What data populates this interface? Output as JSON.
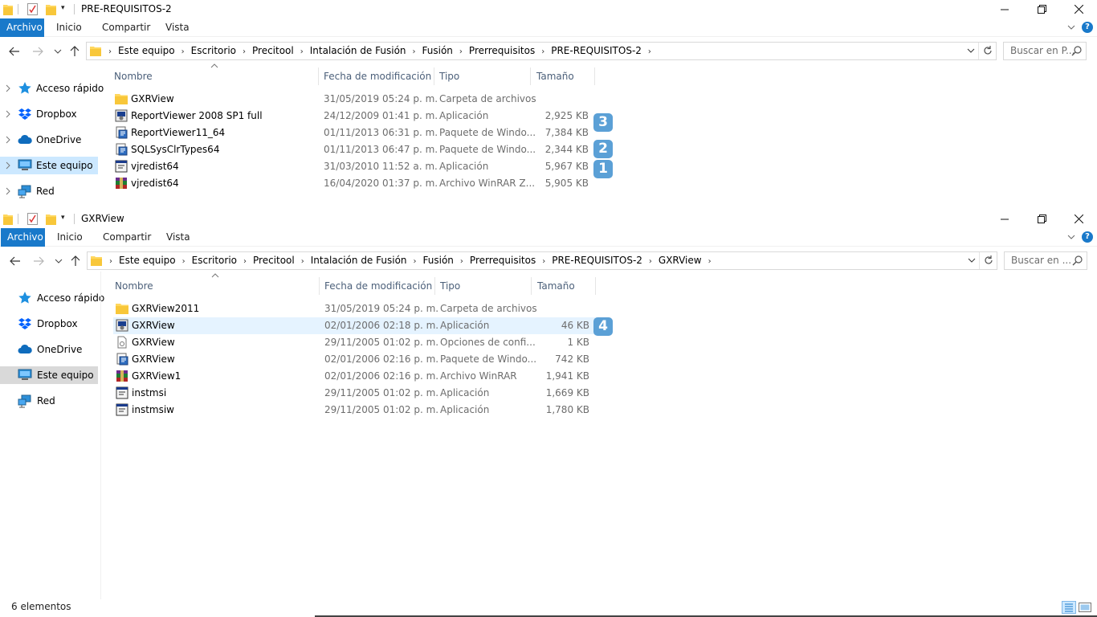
{
  "windows": [
    {
      "title": "PRE-REQUISITOS-2",
      "ribbon": {
        "file": "Archivo",
        "home": "Inicio",
        "share": "Compartir",
        "view": "Vista"
      },
      "breadcrumbs": [
        "Este equipo",
        "Escritorio",
        "Precitool",
        "Intalación de Fusión",
        "Fusión",
        "Prerrequisitos",
        "PRE-REQUISITOS-2"
      ],
      "search_placeholder": "Buscar en P...",
      "nav": [
        "Acceso rápido",
        "Dropbox",
        "OneDrive",
        "Este equipo",
        "Red"
      ],
      "columns": {
        "name": "Nombre",
        "date": "Fecha de modificación",
        "type": "Tipo",
        "size": "Tamaño"
      },
      "files": [
        {
          "name": "GXRView",
          "date": "31/05/2019 05:24 p. m.",
          "type": "Carpeta de archivos",
          "size": "",
          "icon": "folder-icon"
        },
        {
          "name": "ReportViewer 2008 SP1 full",
          "date": "24/12/2009 01:41 p. m.",
          "type": "Aplicación",
          "size": "2,925 KB",
          "icon": "installer-icon"
        },
        {
          "name": "ReportViewer11_64",
          "date": "01/11/2013 06:31 p. m.",
          "type": "Paquete de Windo...",
          "size": "7,384 KB",
          "icon": "msi-package-icon"
        },
        {
          "name": "SQLSysClrTypes64",
          "date": "01/11/2013 06:47 p. m.",
          "type": "Paquete de Windo...",
          "size": "2,344 KB",
          "icon": "msi-package-icon"
        },
        {
          "name": "vjredist64",
          "date": "31/03/2010 11:52 a. m.",
          "type": "Aplicación",
          "size": "5,967 KB",
          "icon": "application-icon"
        },
        {
          "name": "vjredist64",
          "date": "16/04/2020 01:37 p. m.",
          "type": "Archivo WinRAR Z...",
          "size": "5,905 KB",
          "icon": "winrar-archive-icon"
        }
      ],
      "badges": [
        "3",
        "2",
        "1"
      ]
    },
    {
      "title": "GXRView",
      "ribbon": {
        "file": "Archivo",
        "home": "Inicio",
        "share": "Compartir",
        "view": "Vista"
      },
      "breadcrumbs": [
        "Este equipo",
        "Escritorio",
        "Precitool",
        "Intalación de Fusión",
        "Fusión",
        "Prerrequisitos",
        "PRE-REQUISITOS-2",
        "GXRView"
      ],
      "search_placeholder": "Buscar en ...",
      "nav": [
        "Acceso rápido",
        "Dropbox",
        "OneDrive",
        "Este equipo",
        "Red"
      ],
      "columns": {
        "name": "Nombre",
        "date": "Fecha de modificación",
        "type": "Tipo",
        "size": "Tamaño"
      },
      "files": [
        {
          "name": "GXRView2011",
          "date": "31/05/2019 05:24 p. m.",
          "type": "Carpeta de archivos",
          "size": "",
          "icon": "folder-icon"
        },
        {
          "name": "GXRView",
          "date": "02/01/2006 02:18 p. m.",
          "type": "Aplicación",
          "size": "46 KB",
          "icon": "installer-icon"
        },
        {
          "name": "GXRView",
          "date": "29/11/2005 01:02 p. m.",
          "type": "Opciones de confi...",
          "size": "1 KB",
          "icon": "config-file-icon"
        },
        {
          "name": "GXRView",
          "date": "02/01/2006 02:16 p. m.",
          "type": "Paquete de Windo...",
          "size": "742 KB",
          "icon": "msi-package-icon"
        },
        {
          "name": "GXRView1",
          "date": "02/01/2006 02:16 p. m.",
          "type": "Archivo WinRAR",
          "size": "1,941 KB",
          "icon": "winrar-archive-icon"
        },
        {
          "name": "instmsi",
          "date": "29/11/2005 01:02 p. m.",
          "type": "Aplicación",
          "size": "1,669 KB",
          "icon": "application-icon"
        },
        {
          "name": "instmsiw",
          "date": "29/11/2005 01:02 p. m.",
          "type": "Aplicación",
          "size": "1,780 KB",
          "icon": "application-icon"
        }
      ],
      "badges": [
        "4"
      ],
      "status": "6 elementos"
    }
  ]
}
